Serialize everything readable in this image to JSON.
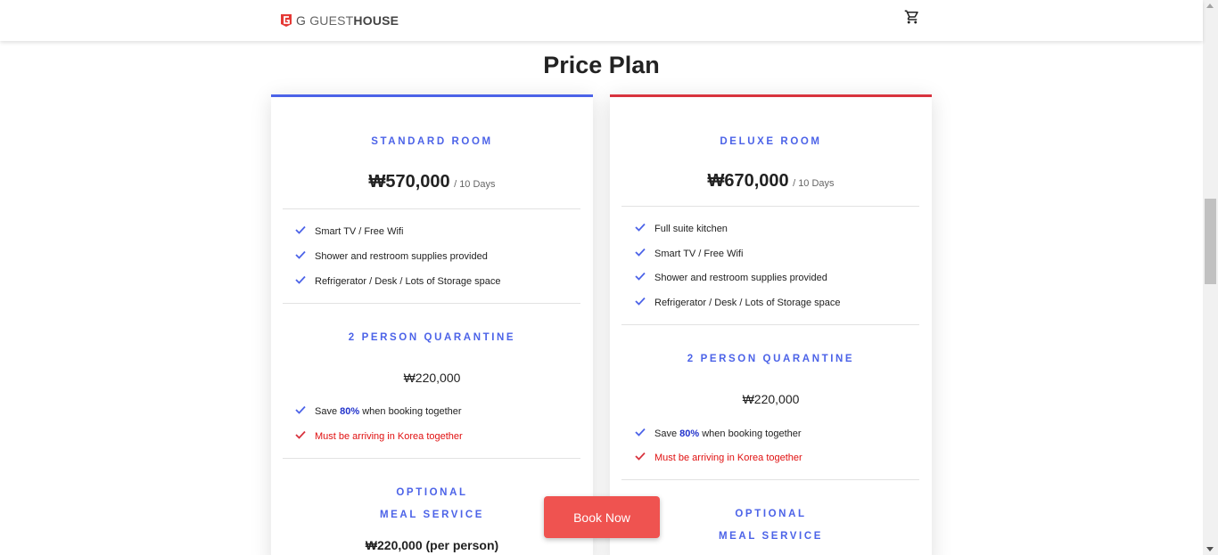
{
  "header": {
    "logo_g": "G",
    "logo_guest": "GUEST",
    "logo_house": "HOUSE",
    "cart_icon": "cart-icon"
  },
  "page_title": "Price Plan",
  "colors": {
    "standard_accent": "#4c63e8",
    "deluxe_accent": "#d8333e",
    "book_button": "#ef5350",
    "highlight": "#2233cc",
    "warning": "#e01010"
  },
  "plans": [
    {
      "title": "STANDARD ROOM",
      "price": "₩570,000",
      "period": "/ 10 Days",
      "features": [
        "Smart TV / Free Wifi",
        "Shower and restroom supplies provided",
        "Refrigerator / Desk / Lots of Storage space"
      ],
      "quarantine": {
        "title": "2 PERSON QUARANTINE",
        "price": "₩220,000",
        "save_prefix": "Save ",
        "save_pct": "80%",
        "save_suffix": " when booking together",
        "warning": "Must be arriving in Korea together"
      },
      "optional": {
        "line1": "OPTIONAL",
        "line2": "MEAL SERVICE",
        "price": "₩220,000 (per person)"
      }
    },
    {
      "title": "DELUXE ROOM",
      "price": "₩670,000",
      "period": "/ 10 Days",
      "features": [
        "Full suite kitchen",
        "Smart TV / Free Wifi",
        "Shower and restroom supplies provided",
        "Refrigerator / Desk / Lots of Storage space"
      ],
      "quarantine": {
        "title": "2 PERSON QUARANTINE",
        "price": "₩220,000",
        "save_prefix": "Save ",
        "save_pct": "80%",
        "save_suffix": " when booking together",
        "warning": "Must be arriving in Korea together"
      },
      "optional": {
        "line1": "OPTIONAL",
        "line2": "MEAL SERVICE"
      }
    }
  ],
  "book_button": "Book Now"
}
